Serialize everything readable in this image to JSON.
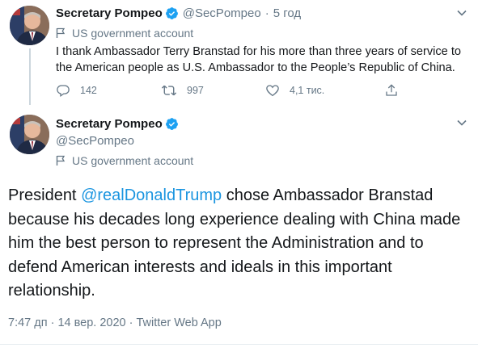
{
  "tweet1": {
    "name": "Secretary Pompeo",
    "handle": "@SecPompeo",
    "separator": "·",
    "time_ago": "5 год",
    "gov_label": "US government account",
    "text": "I thank Ambassador Terry Branstad for his more than three years of service to the American people as U.S. Ambassador to the People’s Republic of China.",
    "replies": "142",
    "retweets": "997",
    "likes": "4,1 тис."
  },
  "tweet2": {
    "name": "Secretary Pompeo",
    "handle": "@SecPompeo",
    "gov_label": "US government account",
    "text_before": "President ",
    "mention": "@realDonaldTrump",
    "text_after": " chose Ambassador Branstad because his decades long experience dealing with China made him the best person to represent the Administration and to defend American interests and ideals in this important relationship.",
    "meta": "7:47 дп · 14 вер. 2020 · Twitter Web App"
  },
  "colors": {
    "text": "#14171a",
    "secondary": "#657786",
    "accent": "#1b95e0",
    "verified": "#1da1f2",
    "divider": "#e6ecf0"
  },
  "icons": [
    "verified-badge-icon",
    "chevron-down-icon",
    "flag-icon",
    "reply-icon",
    "retweet-icon",
    "like-icon",
    "share-icon"
  ]
}
